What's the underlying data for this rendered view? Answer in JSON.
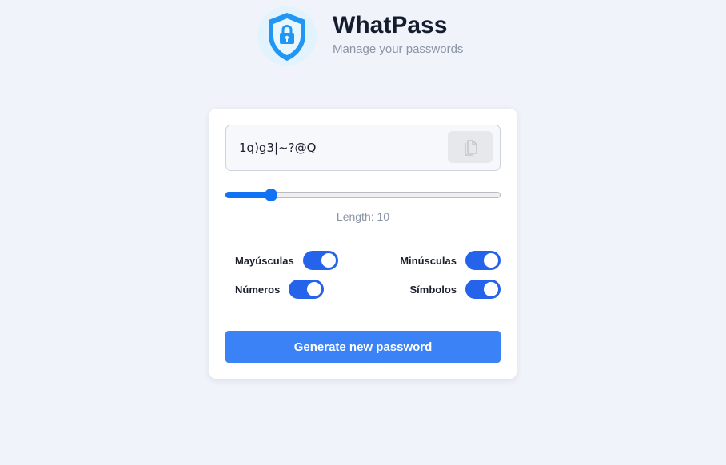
{
  "header": {
    "title": "WhatPass",
    "subtitle": "Manage your passwords",
    "logo_icon": "shield-lock-icon"
  },
  "generator": {
    "password": "1q)g3|~?@Q",
    "copy_icon": "copy-icon",
    "length_value": 10,
    "length_min": 4,
    "length_max": 40,
    "length_label": "Length: 10"
  },
  "options": {
    "uppercase": {
      "label": "Mayúsculas",
      "enabled": true
    },
    "lowercase": {
      "label": "Minúsculas",
      "enabled": true
    },
    "numbers": {
      "label": "Números",
      "enabled": true
    },
    "symbols": {
      "label": "Símbolos",
      "enabled": true
    }
  },
  "actions": {
    "generate_label": "Generate new password"
  },
  "colors": {
    "accent": "#3b82f6",
    "toggle_on": "#2563eb",
    "slider": "#1173f4",
    "background": "#f0f3fa"
  }
}
